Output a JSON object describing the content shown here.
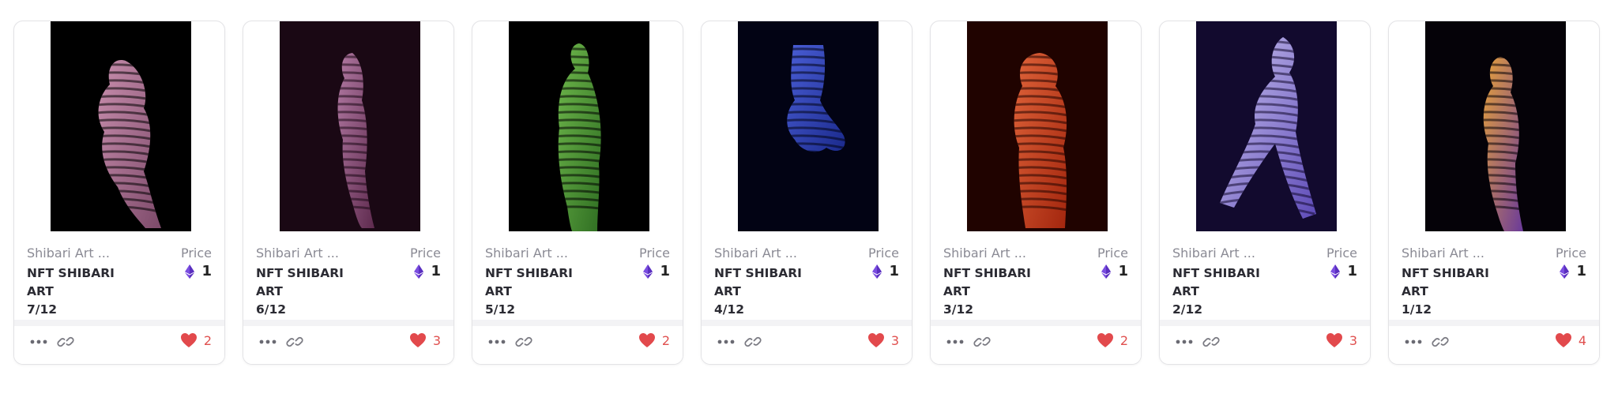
{
  "accent_heart": "#e2494c",
  "accent_eth": "#7a4de0",
  "cards": [
    {
      "collection": "Shibari Art ...",
      "price_label": "Price",
      "name": "NFT SHIBARI ART",
      "edition": "7/12",
      "price": "1",
      "likes": "2",
      "palette": [
        "#000000",
        "#7d4a6a",
        "#c98fae"
      ]
    },
    {
      "collection": "Shibari Art ...",
      "price_label": "Price",
      "name": "NFT SHIBARI ART",
      "edition": "6/12",
      "price": "1",
      "likes": "3",
      "palette": [
        "#1a0814",
        "#5e2a4e",
        "#b27aa3"
      ]
    },
    {
      "collection": "Shibari Art ...",
      "price_label": "Price",
      "name": "NFT SHIBARI ART",
      "edition": "5/12",
      "price": "1",
      "likes": "2",
      "palette": [
        "#000000",
        "#2f6e22",
        "#6fb84c"
      ]
    },
    {
      "collection": "Shibari Art ...",
      "price_label": "Price",
      "name": "NFT SHIBARI ART",
      "edition": "4/12",
      "price": "1",
      "likes": "3",
      "palette": [
        "#020314",
        "#1b2a8c",
        "#4a5ed6"
      ]
    },
    {
      "collection": "Shibari Art ...",
      "price_label": "Price",
      "name": "NFT SHIBARI ART",
      "edition": "3/12",
      "price": "1",
      "likes": "2",
      "palette": [
        "#200300",
        "#a3260e",
        "#e0643a"
      ]
    },
    {
      "collection": "Shibari Art ...",
      "price_label": "Price",
      "name": "NFT SHIBARI ART",
      "edition": "2/12",
      "price": "1",
      "likes": "3",
      "palette": [
        "#120a2e",
        "#5e4bb8",
        "#c9c2ee"
      ]
    },
    {
      "collection": "Shibari Art ...",
      "price_label": "Price",
      "name": "NFT SHIBARI ART",
      "edition": "1/12",
      "price": "1",
      "likes": "4",
      "palette": [
        "#050208",
        "#6a3a9a",
        "#e7a23a"
      ]
    }
  ]
}
